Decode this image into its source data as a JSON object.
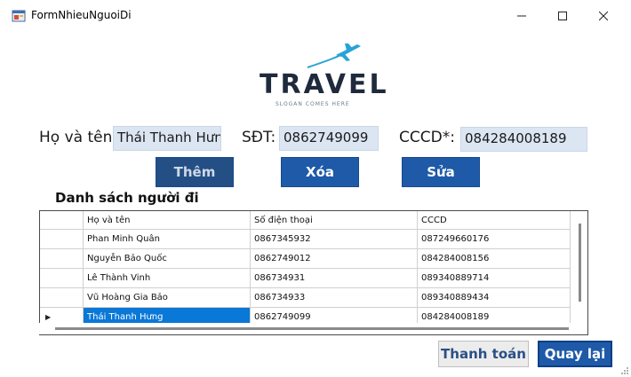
{
  "window": {
    "title": "FormNhieuNguoiDi"
  },
  "logo": {
    "word": "TRAVEL",
    "slogan": "SLOGAN COMES HERE"
  },
  "form": {
    "name_label": "Họ và tên:",
    "name_value": "Thái Thanh Hưng",
    "phone_label": "SĐT:",
    "phone_value": "0862749099",
    "id_label": "CCCD*:",
    "id_value": "084284008189"
  },
  "actions": {
    "add_label": "Thêm",
    "delete_label": "Xóa",
    "edit_label": "Sửa"
  },
  "list": {
    "title": "Danh sách người đi",
    "columns": [
      "Họ và tên",
      "Số điện thoại",
      "CCCD"
    ],
    "rows": [
      {
        "name": "Phan Minh Quân",
        "phone": "0867345932",
        "id": "087249660176"
      },
      {
        "name": "Nguyễn Bảo Quốc",
        "phone": "0862749012",
        "id": "084284008156"
      },
      {
        "name": "Lê Thành Vinh",
        "phone": "086734931",
        "id": "089340889714"
      },
      {
        "name": "Vũ Hoàng Gia Bảo",
        "phone": "086734933",
        "id": "089340889434"
      },
      {
        "name": "Thái Thanh Hưng",
        "phone": "0862749099",
        "id": "084284008189"
      }
    ],
    "selected_row": 4
  },
  "footer": {
    "pay_label": "Thanh toán",
    "back_label": "Quay lại"
  },
  "colors": {
    "primary_button": "#1e5aa8",
    "input_bg": "#dce6f3",
    "selection": "#0a78d7",
    "logo_accent": "#29a3d6"
  }
}
